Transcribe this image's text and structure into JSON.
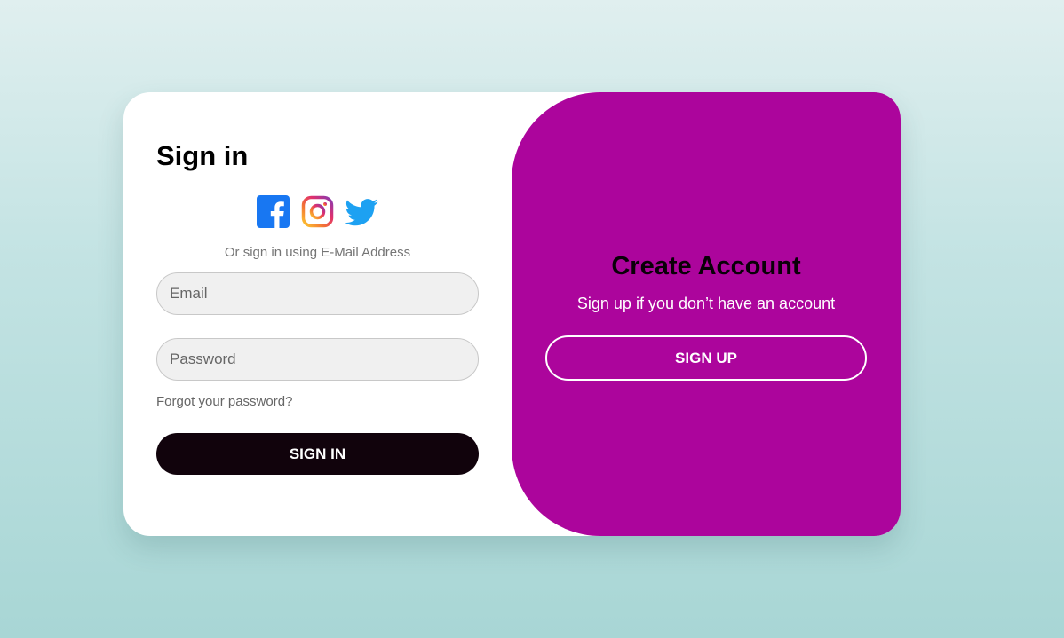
{
  "signin": {
    "title": "Sign in",
    "social": {
      "icons": [
        "facebook-icon",
        "instagram-icon",
        "twitter-icon"
      ],
      "colors": {
        "facebook": "#1877f2",
        "twitter": "#1da1f2"
      }
    },
    "alt_text": "Or sign in using E-Mail Address",
    "email": {
      "placeholder": "Email",
      "value": ""
    },
    "password": {
      "placeholder": "Password",
      "value": ""
    },
    "forgot": "Forgot your password?",
    "button": "SIGN IN",
    "button_color": "#11030c"
  },
  "signup": {
    "title": "Create Account",
    "subtitle": "Sign up if you don’t have an account",
    "button": "SIGN UP",
    "panel_color": "#ac059c"
  }
}
